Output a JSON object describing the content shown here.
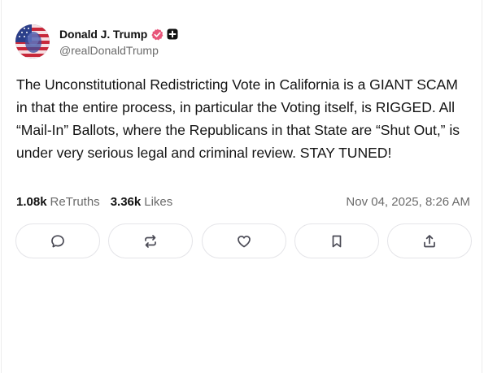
{
  "post": {
    "author": {
      "display_name": "Donald J. Trump",
      "handle": "@realDonaldTrump",
      "avatar_icon": "flag-portrait-avatar",
      "verified_icon": "verified-badge-icon",
      "verified_color": "#e8557a",
      "plus_icon": "plus-badge-icon"
    },
    "text": "The Unconstitutional Redistricting Vote in California is a GIANT SCAM in that the entire process, in particular the Voting itself, is RIGGED. All “Mail-In” Ballots, where the Republicans in that State are “Shut Out,” is under very serious legal and criminal review. STAY TUNED!",
    "stats": {
      "retruths_count": "1.08k",
      "retruths_label": "ReTruths",
      "likes_count": "3.36k",
      "likes_label": "Likes"
    },
    "timestamp": "Nov 04, 2025, 8:26 AM",
    "actions": [
      {
        "name": "reply",
        "icon": "comment-icon"
      },
      {
        "name": "retruth",
        "icon": "repost-icon"
      },
      {
        "name": "like",
        "icon": "heart-icon"
      },
      {
        "name": "bookmark",
        "icon": "bookmark-icon"
      },
      {
        "name": "share",
        "icon": "share-icon"
      }
    ]
  },
  "colors": {
    "text": "#111111",
    "muted": "#6b6b6b",
    "border": "#e4e4e8",
    "icon": "#4a4a55"
  }
}
